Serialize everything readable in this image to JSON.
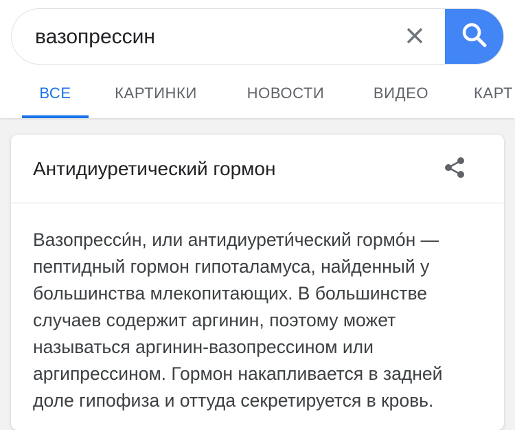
{
  "search": {
    "query": "вазопрессин"
  },
  "tabs": [
    {
      "label": "ВСЕ",
      "active": true
    },
    {
      "label": "КАРТИНКИ",
      "active": false
    },
    {
      "label": "НОВОСТИ",
      "active": false
    },
    {
      "label": "ВИДЕО",
      "active": false
    },
    {
      "label": "КАРТ",
      "active": false
    }
  ],
  "card": {
    "title": "Антидиуретический гормон",
    "description": "Вазопресси́н, или антидиурети́ческий гормо́н — пептидный гормон гипоталамуса, найденный у большинства млекопитающих. В большинстве случаев содержит аргинин, поэтому может называться аргинин-вазопрессином или аргипрессином. Гормон накапливается в задней доле гипофиза и оттуда секретируется в кровь."
  },
  "icons": {
    "clear": "close-icon",
    "search": "search-icon",
    "share": "share-icon"
  },
  "colors": {
    "accent": "#1a73e8",
    "search_button": "#4285f4",
    "tab_inactive": "#5f6368",
    "text": "#202124"
  }
}
